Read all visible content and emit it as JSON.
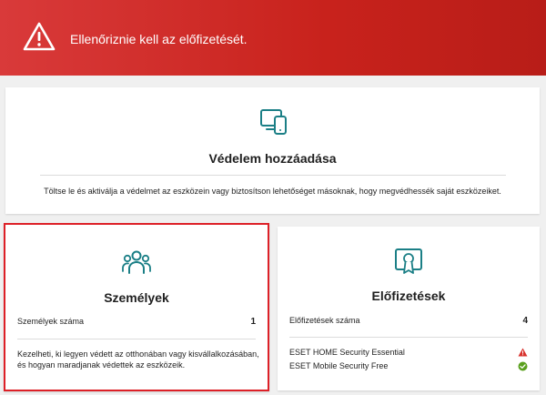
{
  "banner": {
    "message": "Ellenőriznie kell az előfizetését.",
    "icon": "warning-triangle-icon",
    "color": "#d12e2a"
  },
  "protection": {
    "icon": "devices-icon",
    "title": "Védelem hozzáadása",
    "description": "Töltse le és aktiválja a védelmet az eszközein vagy biztosítson lehetőséget másoknak, hogy megvédhessék saját eszközeiket."
  },
  "people": {
    "icon": "people-icon",
    "title": "Személyek",
    "count_label": "Személyek száma",
    "count_value": "1",
    "description": "Kezelheti, ki legyen védett az otthonában vagy kisvállalkozásában, és hogyan maradjanak védettek az eszközeik."
  },
  "subscriptions": {
    "icon": "certificate-icon",
    "title": "Előfizetések",
    "count_label": "Előfizetések száma",
    "count_value": "4",
    "items": [
      {
        "name": "ESET HOME Security Essential",
        "status_icon": "warning-icon"
      },
      {
        "name": "ESET Mobile Security Free",
        "status_icon": "check-circle-icon"
      }
    ]
  },
  "colors": {
    "accent_teal": "#1b7f86",
    "highlight_border": "#dd2027",
    "warning_red": "#d8322d",
    "ok_green": "#5aa01e"
  }
}
